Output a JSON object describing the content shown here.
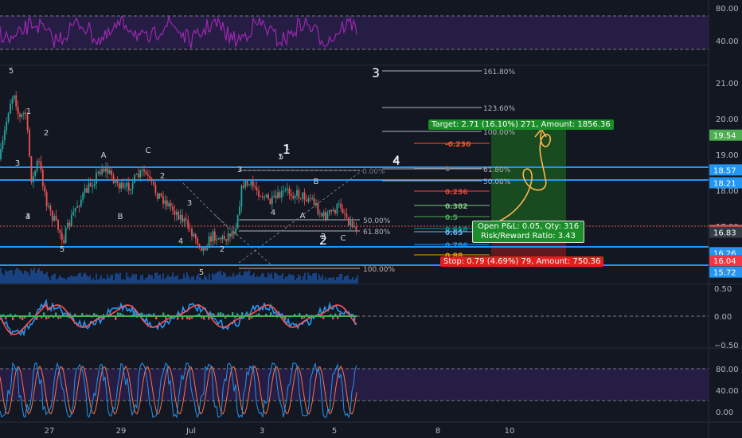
{
  "colors": {
    "background": "#131722",
    "up": "#26a69a",
    "down": "#ef5350",
    "hline": "#2196f3",
    "rsi": "#9c27b0",
    "stoch_k": "#2196f3",
    "stoch_d": "#ff7043",
    "band": "#2a1f4a",
    "target_box": "#1b5e20",
    "stop_box": "#7f1d1d"
  },
  "price_axis": {
    "ticks": [
      "21.00",
      "20.00",
      "19.00",
      "18.00",
      "17.00",
      "16.00"
    ],
    "badges": [
      {
        "label": "19.54",
        "color": "#4caf50",
        "value": 19.54
      },
      {
        "label": "18.57",
        "color": "#2196f3",
        "value": 18.57
      },
      {
        "label": "18.21",
        "color": "#2196f3",
        "value": 18.21
      },
      {
        "label": "16.88",
        "color": "#ef5350",
        "value": 16.88
      },
      {
        "label": "16.83",
        "color": "#363a45",
        "value": 16.83
      },
      {
        "label": "16.26",
        "color": "#2196f3",
        "value": 16.26
      },
      {
        "label": "16.04",
        "color": "#f23645",
        "value": 16.04
      },
      {
        "label": "15.72",
        "color": "#2196f3",
        "value": 15.72
      }
    ]
  },
  "rsi_axis": {
    "ticks": [
      "80.00",
      "40.00"
    ]
  },
  "macd_axis": {
    "ticks": [
      "0.50",
      "0.00",
      "−0.50"
    ]
  },
  "stoch_axis": {
    "ticks": [
      "80.00",
      "40.00",
      "0.00"
    ]
  },
  "time_axis": {
    "labels": [
      "27",
      "29",
      "Jul",
      "3",
      "5",
      "8",
      "10"
    ]
  },
  "fib_right": [
    "161.80%",
    "123.60%",
    "100.00%",
    "61.80%",
    "50.00%",
    "0.00%"
  ],
  "fib_left": [
    "50.00%",
    "61.80%",
    "100.00%"
  ],
  "fib_ext": [
    {
      "label": "-0.236",
      "color": "#ff5722"
    },
    {
      "label": "0",
      "color": "#787b86"
    },
    {
      "label": "0.236",
      "color": "#f44336"
    },
    {
      "label": "0.382",
      "color": "#81c784"
    },
    {
      "label": "0.5",
      "color": "#4caf50"
    },
    {
      "label": "0.618",
      "color": "#009688"
    },
    {
      "label": "0.65",
      "color": "#64b5f6"
    },
    {
      "label": "0.786",
      "color": "#2196f3"
    },
    {
      "label": "0.88",
      "color": "#ff9800"
    }
  ],
  "wave_labels": [
    "5",
    "1",
    "2",
    "3",
    "4",
    "5",
    "A",
    "B",
    "C",
    "2",
    "3",
    "4",
    "5",
    "1",
    "2",
    "3",
    "4",
    "5",
    "A",
    "B",
    "C",
    "3",
    "1",
    "2",
    "4"
  ],
  "large_waves": [
    "3",
    "1",
    "4",
    "2"
  ],
  "annotations": {
    "target": "Target: 2.71 (16.10%) 271, Amount: 1856.36",
    "open_pnl": "Open P&L: 0.05, Qty: 316",
    "risk_reward": "Risk/Reward Ratio: 3.43",
    "stop": "Stop: 0.79 (4.69%) 79, Amount: 750.36"
  },
  "chart_data": {
    "type": "line",
    "title": "",
    "ylim": [
      15.5,
      21.5
    ],
    "x": [
      "27",
      "29",
      "Jul",
      "3",
      "5"
    ],
    "series": [
      {
        "values": [
          19.2,
          18.0,
          17.2,
          18.4,
          17.0
        ]
      }
    ],
    "horizontal_levels": [
      18.57,
      18.21,
      16.26,
      15.72
    ],
    "grid": false
  }
}
